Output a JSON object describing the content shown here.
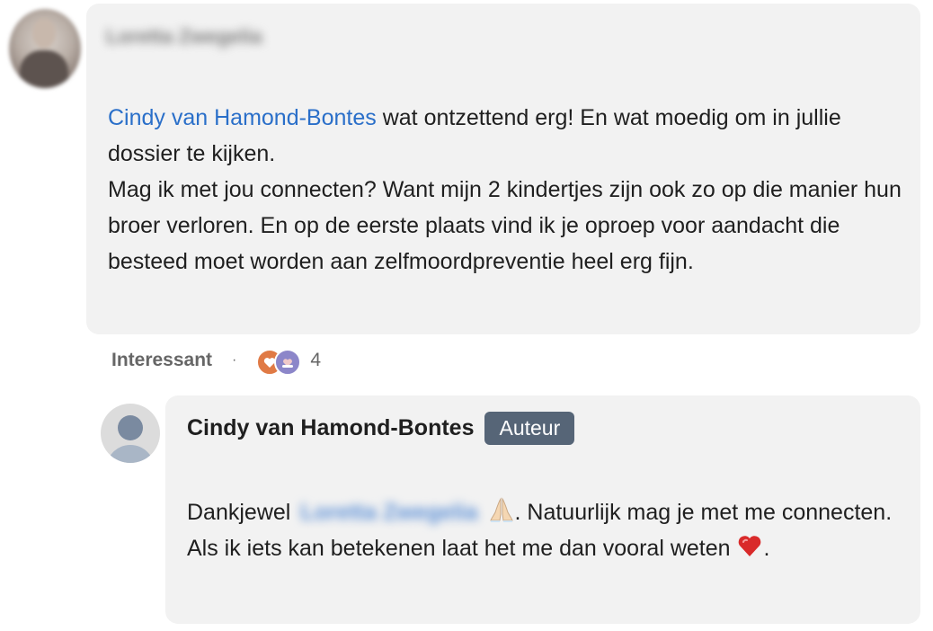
{
  "comment": {
    "author_name_blurred": "Loretta Zwegelia",
    "mention": "Cindy van Hamond-Bontes",
    "text_after_mention": " wat ontzettend erg! En wat moedig om in jullie dossier te kijken.",
    "text_line2": "Mag ik met jou connecten? Want mijn 2 kindertjes zijn ook zo op die manier hun broer verloren. En op de eerste plaats vind ik je oproep voor aandacht die besteed moet worden aan zelfmoordpreventie heel erg fijn.",
    "action_label": "Interessant",
    "separator": "·",
    "reaction_count": "4",
    "reaction_icons": [
      "heart-reaction-icon",
      "support-reaction-icon"
    ]
  },
  "reply": {
    "author_name": "Cindy van Hamond-Bontes",
    "badge": "Auteur",
    "text_start": "Dankjewel",
    "mention_blurred": "Loretta Zwegelia",
    "text_after_mention": ". Natuurlijk mag je met me connecten. Als ik iets kan betekenen laat het me dan vooral weten",
    "text_end": ".",
    "emoji_icons": [
      "folded-hands-emoji",
      "red-heart-emoji"
    ]
  },
  "colors": {
    "bubble_bg": "#f2f2f2",
    "mention": "#2a6fc9",
    "badge_bg": "#566577",
    "heart": "#d92a2a"
  }
}
